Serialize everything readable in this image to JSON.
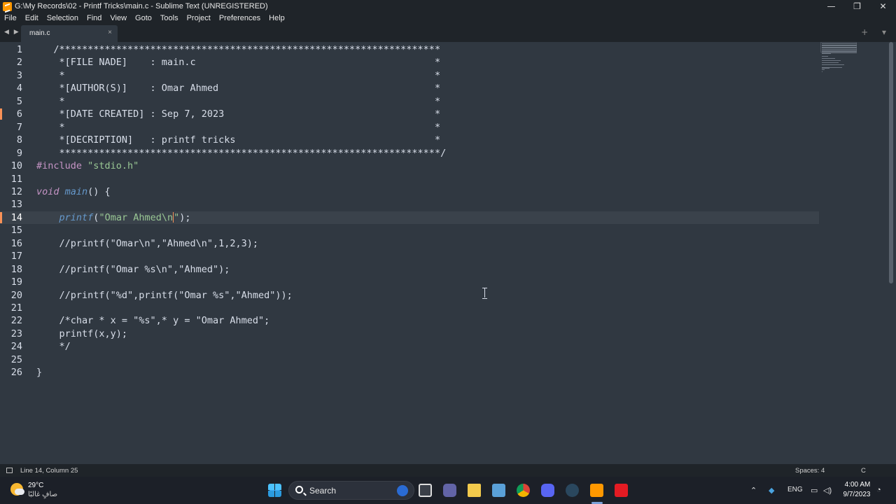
{
  "window": {
    "title": "G:\\My Records\\02 - Printf Tricks\\main.c - Sublime Text (UNREGISTERED)",
    "minimize_glyph": "—",
    "maximize_glyph": "❐",
    "close_glyph": "✕"
  },
  "menu": [
    "File",
    "Edit",
    "Selection",
    "Find",
    "View",
    "Goto",
    "Tools",
    "Project",
    "Preferences",
    "Help"
  ],
  "tabbar": {
    "nav_glyph": "◀ ▶",
    "tab_label": "main.c",
    "tab_close": "×",
    "right_glyphs": "+ ▾"
  },
  "editor": {
    "current_line": 14,
    "lines": [
      {
        "n": "1",
        "segments": [
          {
            "t": "   /*******************************************************************",
            "c": "cmt"
          }
        ]
      },
      {
        "n": "2",
        "segments": [
          {
            "t": "    *[FILE NADE]    : main.c                                          *",
            "c": "cmt"
          }
        ]
      },
      {
        "n": "3",
        "segments": [
          {
            "t": "    *                                                                 *",
            "c": "cmt"
          }
        ]
      },
      {
        "n": "4",
        "segments": [
          {
            "t": "    *[AUTHOR(S)]    : Omar Ahmed                                      *",
            "c": "cmt"
          }
        ]
      },
      {
        "n": "5",
        "segments": [
          {
            "t": "    *                                                                 *",
            "c": "cmt"
          }
        ]
      },
      {
        "n": "6",
        "segments": [
          {
            "t": "    *[DATE CREATED] : Sep 7, 2023                                     *",
            "c": "cmt"
          }
        ]
      },
      {
        "n": "7",
        "segments": [
          {
            "t": "    *                                                                 *",
            "c": "cmt"
          }
        ]
      },
      {
        "n": "8",
        "segments": [
          {
            "t": "    *[DECRIPTION]   : printf tricks                                   *",
            "c": "cmt"
          }
        ]
      },
      {
        "n": "9",
        "segments": [
          {
            "t": "    *******************************************************************/",
            "c": "cmt"
          }
        ]
      },
      {
        "n": "10",
        "segments": [
          {
            "t": "#include ",
            "c": "pp"
          },
          {
            "t": "\"stdio.h\"",
            "c": "str"
          }
        ]
      },
      {
        "n": "11",
        "segments": []
      },
      {
        "n": "12",
        "segments": [
          {
            "t": "void",
            "c": "kw"
          },
          {
            "t": " ",
            "c": ""
          },
          {
            "t": "main",
            "c": "fn"
          },
          {
            "t": "() {",
            "c": ""
          }
        ]
      },
      {
        "n": "13",
        "segments": []
      },
      {
        "n": "14",
        "segments": [
          {
            "t": "    ",
            "c": ""
          },
          {
            "t": "printf",
            "c": "fn"
          },
          {
            "t": "(",
            "c": ""
          },
          {
            "t": "\"Omar Ahmed\\n",
            "c": "str"
          },
          {
            "t": "",
            "c": "cursor"
          },
          {
            "t": "\"",
            "c": "str"
          },
          {
            "t": ");",
            "c": ""
          }
        ]
      },
      {
        "n": "15",
        "segments": []
      },
      {
        "n": "16",
        "segments": [
          {
            "t": "    //printf(\"Omar\\n\",\"Ahmed\\n\",1,2,3);",
            "c": "cmt"
          }
        ]
      },
      {
        "n": "17",
        "segments": []
      },
      {
        "n": "18",
        "segments": [
          {
            "t": "    //printf(\"Omar %s\\n\",\"Ahmed\");",
            "c": "cmt"
          }
        ]
      },
      {
        "n": "19",
        "segments": []
      },
      {
        "n": "20",
        "segments": [
          {
            "t": "    //printf(\"%d\",printf(\"Omar %s\",\"Ahmed\"));",
            "c": "cmt"
          }
        ]
      },
      {
        "n": "21",
        "segments": []
      },
      {
        "n": "22",
        "segments": [
          {
            "t": "    /*char * x = \"%s\",* y = \"Omar Ahmed\";",
            "c": "cmt"
          }
        ]
      },
      {
        "n": "23",
        "segments": [
          {
            "t": "    printf(x,y);",
            "c": "cmt"
          }
        ]
      },
      {
        "n": "24",
        "segments": [
          {
            "t": "    */",
            "c": "cmt"
          }
        ]
      },
      {
        "n": "25",
        "segments": []
      },
      {
        "n": "26",
        "segments": [
          {
            "t": "}",
            "c": ""
          }
        ]
      }
    ]
  },
  "statusbar": {
    "position": "Line 14, Column 25",
    "spaces": "Spaces: 4",
    "syntax": "C"
  },
  "taskbar": {
    "temperature": "29°C",
    "condition": "صافٍ غالبًا",
    "search_label": "Search",
    "language": "ENG",
    "time": "4:00 AM",
    "date": "9/7/2023"
  },
  "colors": {
    "background": "#303841",
    "chrome": "#1f2429",
    "keyword": "#c594c5",
    "function": "#6699cc",
    "string": "#99c794",
    "cursor": "#f99157"
  }
}
